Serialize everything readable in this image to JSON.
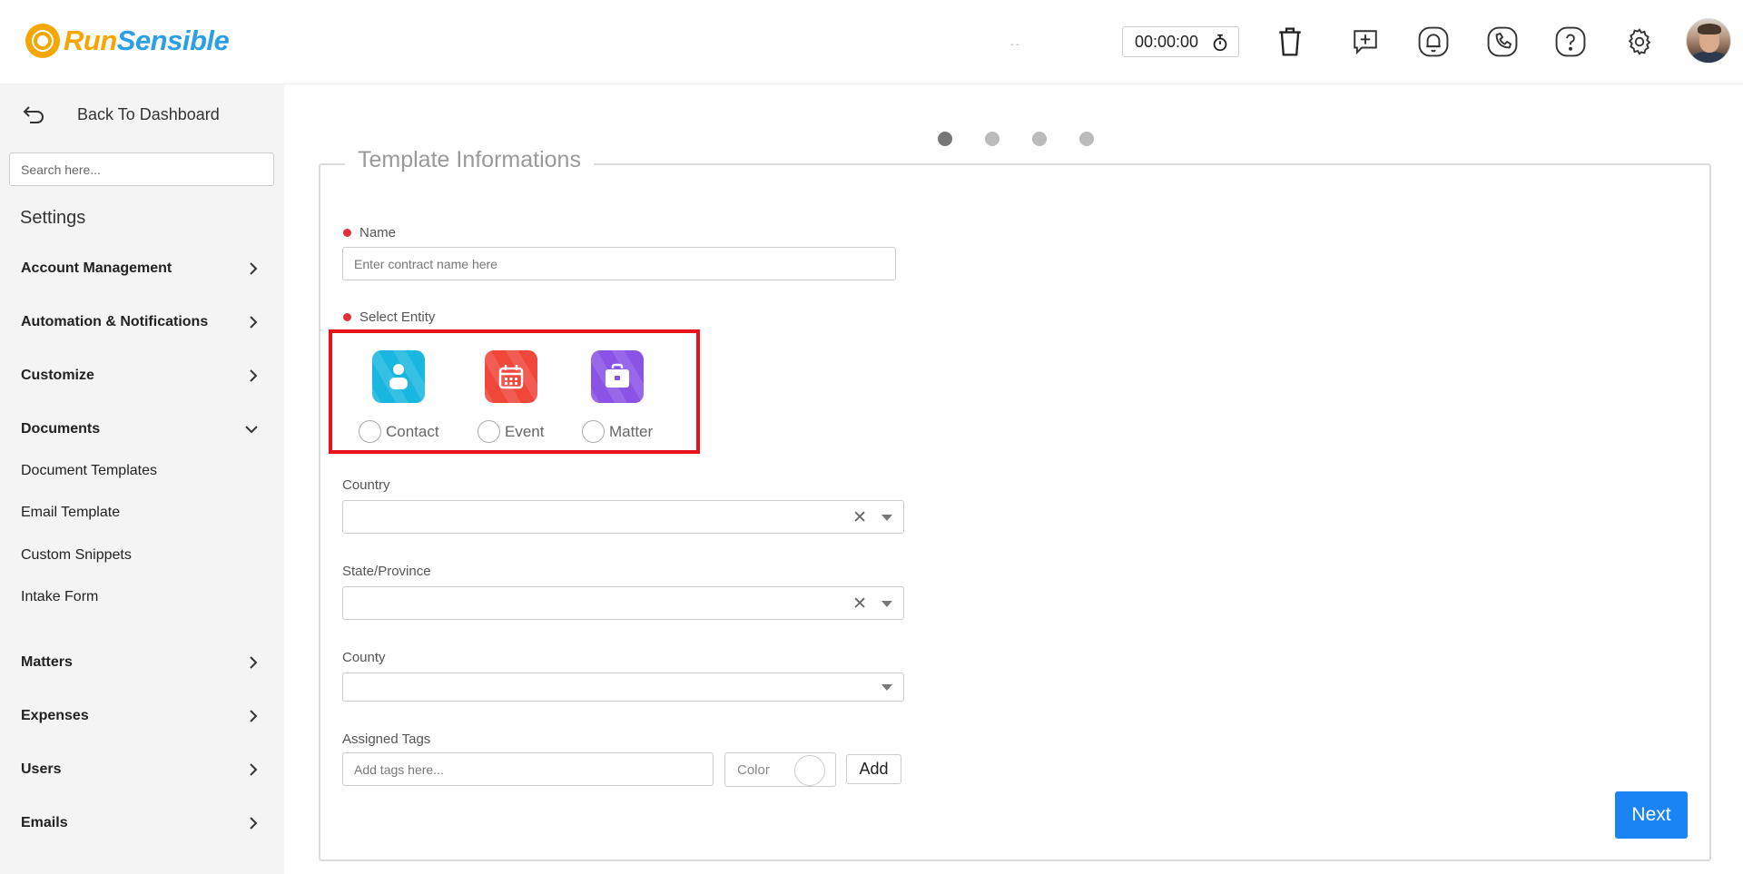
{
  "header": {
    "logo": {
      "part1": "Run",
      "part2": "Sensible"
    },
    "status_text": "- -",
    "timer": "00:00:00",
    "icons": [
      "trash-icon",
      "add-comment-icon",
      "bell-icon",
      "phone-icon",
      "help-icon",
      "gear-icon"
    ]
  },
  "sidebar": {
    "back_label": "Back To Dashboard",
    "search_placeholder": "Search here...",
    "settings_title": "Settings",
    "nav": [
      {
        "label": "Account Management",
        "expanded": false
      },
      {
        "label": "Automation & Notifications",
        "expanded": false
      },
      {
        "label": "Customize",
        "expanded": false
      },
      {
        "label": "Documents",
        "expanded": true
      },
      {
        "label": "Matters",
        "expanded": false
      },
      {
        "label": "Expenses",
        "expanded": false
      },
      {
        "label": "Users",
        "expanded": false
      },
      {
        "label": "Emails",
        "expanded": false
      }
    ],
    "documents_sub": [
      "Document Templates",
      "Email Template",
      "Custom Snippets",
      "Intake Form"
    ]
  },
  "stepper": {
    "steps": 4,
    "current": 1
  },
  "form": {
    "legend": "Template Informations",
    "name_label": "Name",
    "name_placeholder": "Enter contract name here",
    "entity_label": "Select Entity",
    "entities": [
      {
        "label": "Contact",
        "color": "#19b7e0"
      },
      {
        "label": "Event",
        "color": "#f0473b"
      },
      {
        "label": "Matter",
        "color": "#8b52e6"
      }
    ],
    "country_label": "Country",
    "state_label": "State/Province",
    "county_label": "County",
    "tags_label": "Assigned Tags",
    "tags_placeholder": "Add tags here...",
    "color_label": "Color",
    "add_label": "Add",
    "next_label": "Next"
  },
  "colors": {
    "accent": "#1b84f5",
    "required": "#e0313b",
    "highlight": "#e8121b"
  }
}
